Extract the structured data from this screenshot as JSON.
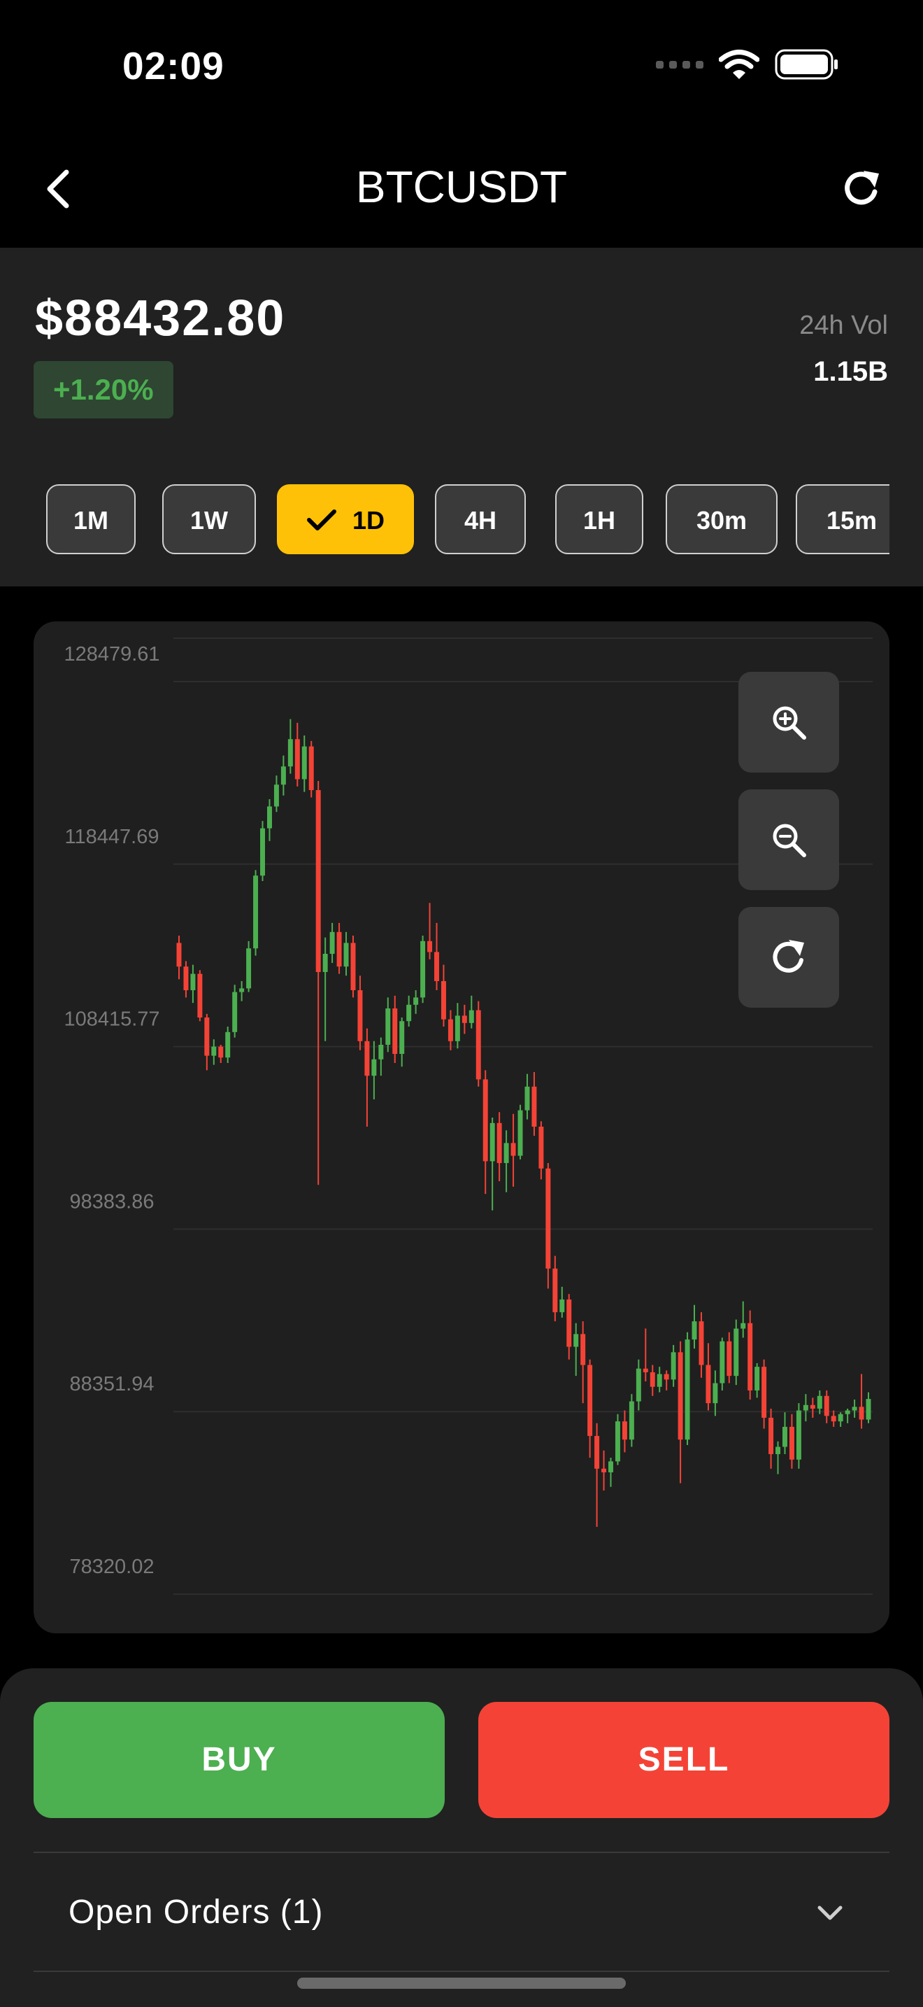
{
  "status_bar": {
    "time": "02:09"
  },
  "nav": {
    "title": "BTCUSDT"
  },
  "price": {
    "value": "$88432.80",
    "change": "+1.20%",
    "volume_label": "24h Vol",
    "volume_value": "1.15B"
  },
  "timeframes": [
    {
      "label": "1M",
      "selected": false
    },
    {
      "label": "1W",
      "selected": false
    },
    {
      "label": "1D",
      "selected": true
    },
    {
      "label": "4H",
      "selected": false
    },
    {
      "label": "1H",
      "selected": false
    },
    {
      "label": "30m",
      "selected": false
    },
    {
      "label": "15m",
      "selected": false
    }
  ],
  "icons": {
    "back": "chevron-left-icon",
    "refresh": "refresh-icon",
    "zoom_in": "zoom-in-icon",
    "zoom_out": "zoom-out-icon",
    "reset": "reset-icon",
    "expand": "chevron-down-icon",
    "check": "check-icon"
  },
  "colors": {
    "up": "#4caf50",
    "down": "#f44336",
    "accent": "#ffc107",
    "card": "#1f1f1f",
    "grid": "#2e2e2e"
  },
  "chart_data": {
    "type": "candlestick",
    "y_ticks": [
      "128479.61",
      "118447.69",
      "108415.77",
      "98383.86",
      "88351.94",
      "78320.02"
    ],
    "ylim": [
      78320.02,
      128479.61
    ],
    "candles": [
      [
        113500,
        113900,
        111500,
        112200
      ],
      [
        112200,
        112500,
        110500,
        110900
      ],
      [
        110900,
        112300,
        110200,
        111800
      ],
      [
        111800,
        112000,
        109200,
        109400
      ],
      [
        109400,
        109600,
        106500,
        107300
      ],
      [
        107300,
        108200,
        106800,
        107800
      ],
      [
        107800,
        107900,
        106900,
        107200
      ],
      [
        107200,
        108900,
        106900,
        108600
      ],
      [
        108600,
        111200,
        108300,
        110800
      ],
      [
        110800,
        111400,
        110300,
        111000
      ],
      [
        111000,
        113600,
        110800,
        113200
      ],
      [
        113200,
        117500,
        112800,
        117200
      ],
      [
        117200,
        120200,
        116900,
        119800
      ],
      [
        119800,
        121400,
        119100,
        121000
      ],
      [
        121000,
        122700,
        120700,
        122200
      ],
      [
        122200,
        123800,
        121600,
        123200
      ],
      [
        123200,
        125800,
        122800,
        124700
      ],
      [
        124700,
        125600,
        122100,
        122500
      ],
      [
        122500,
        124900,
        121800,
        124300
      ],
      [
        124300,
        124600,
        121500,
        121900
      ],
      [
        121900,
        122400,
        100200,
        111900
      ],
      [
        111900,
        113800,
        108100,
        112900
      ],
      [
        112900,
        114600,
        112400,
        114100
      ],
      [
        114100,
        114600,
        111800,
        112200
      ],
      [
        112200,
        114100,
        111700,
        113500
      ],
      [
        113500,
        113900,
        110500,
        110900
      ],
      [
        110900,
        111700,
        107600,
        108100
      ],
      [
        108100,
        108800,
        103400,
        106200
      ],
      [
        106200,
        108100,
        104900,
        107100
      ],
      [
        107100,
        108300,
        106200,
        107900
      ],
      [
        107900,
        110500,
        107500,
        109900
      ],
      [
        109900,
        110600,
        106900,
        107400
      ],
      [
        107400,
        109400,
        106700,
        109200
      ],
      [
        109200,
        110600,
        108900,
        110100
      ],
      [
        110100,
        110900,
        109600,
        110500
      ],
      [
        110500,
        113900,
        110200,
        113600
      ],
      [
        113600,
        115700,
        112600,
        113000
      ],
      [
        113000,
        114600,
        110900,
        111400
      ],
      [
        111400,
        112300,
        108900,
        109300
      ],
      [
        109300,
        109800,
        107600,
        108100
      ],
      [
        108100,
        110200,
        107700,
        109500
      ],
      [
        109500,
        110100,
        108500,
        109100
      ],
      [
        109100,
        110600,
        108800,
        109800
      ],
      [
        109800,
        110300,
        105600,
        106000
      ],
      [
        106000,
        106500,
        99700,
        101500
      ],
      [
        101500,
        103900,
        98800,
        103600
      ],
      [
        103600,
        104200,
        100400,
        101400
      ],
      [
        101400,
        103200,
        99800,
        102500
      ],
      [
        102500,
        104100,
        100100,
        101800
      ],
      [
        101800,
        104600,
        101600,
        104300
      ],
      [
        104300,
        106300,
        103800,
        105600
      ],
      [
        105600,
        106400,
        102900,
        103400
      ],
      [
        103400,
        103700,
        100500,
        101100
      ],
      [
        101100,
        101400,
        94500,
        95600
      ],
      [
        95600,
        96300,
        92700,
        93200
      ],
      [
        93200,
        94600,
        92900,
        93900
      ],
      [
        93900,
        94200,
        90600,
        91300
      ],
      [
        91300,
        92600,
        89700,
        92000
      ],
      [
        92000,
        92700,
        88200,
        90300
      ],
      [
        90300,
        90600,
        85200,
        86400
      ],
      [
        86400,
        87100,
        81400,
        84600
      ],
      [
        84600,
        85600,
        83400,
        84400
      ],
      [
        84400,
        85200,
        83600,
        85000
      ],
      [
        85000,
        87600,
        84800,
        87200
      ],
      [
        87200,
        87800,
        85500,
        86200
      ],
      [
        86200,
        88700,
        85800,
        88300
      ],
      [
        88300,
        90600,
        87800,
        90100
      ],
      [
        90100,
        92300,
        89400,
        89900
      ],
      [
        89900,
        90300,
        88600,
        89100
      ],
      [
        89100,
        90200,
        88800,
        89800
      ],
      [
        89800,
        90000,
        88900,
        89500
      ],
      [
        89500,
        91400,
        89100,
        91000
      ],
      [
        91000,
        91600,
        83800,
        86200
      ],
      [
        86200,
        92100,
        85900,
        91700
      ],
      [
        91700,
        93600,
        91200,
        92700
      ],
      [
        92700,
        93200,
        89600,
        90300
      ],
      [
        90300,
        91500,
        87800,
        88200
      ],
      [
        88200,
        90000,
        87500,
        89300
      ],
      [
        89300,
        91800,
        88900,
        91600
      ],
      [
        91600,
        92100,
        89300,
        89700
      ],
      [
        89700,
        92800,
        89200,
        92300
      ],
      [
        92300,
        93800,
        91800,
        92600
      ],
      [
        92600,
        93300,
        88400,
        88900
      ],
      [
        88900,
        90400,
        88500,
        90200
      ],
      [
        90200,
        90600,
        86800,
        87400
      ],
      [
        87400,
        87900,
        84600,
        85400
      ],
      [
        85400,
        86100,
        84300,
        85800
      ],
      [
        85800,
        87700,
        85400,
        86900
      ],
      [
        86900,
        87600,
        84600,
        85100
      ],
      [
        85100,
        88200,
        84600,
        87800
      ],
      [
        87800,
        88700,
        87200,
        88100
      ],
      [
        88100,
        88500,
        87400,
        87900
      ],
      [
        87900,
        88900,
        87600,
        88600
      ],
      [
        88600,
        88900,
        87100,
        87500
      ],
      [
        87500,
        87800,
        86900,
        87200
      ],
      [
        87200,
        87700,
        86900,
        87600
      ],
      [
        87600,
        87900,
        87100,
        87800
      ],
      [
        87800,
        88400,
        87400,
        88000
      ],
      [
        88000,
        89800,
        86800,
        87300
      ],
      [
        87300,
        88800,
        87100,
        88432.8
      ]
    ]
  },
  "actions": {
    "buy": "BUY",
    "sell": "SELL"
  },
  "orders": {
    "label": "Open Orders (1)"
  }
}
